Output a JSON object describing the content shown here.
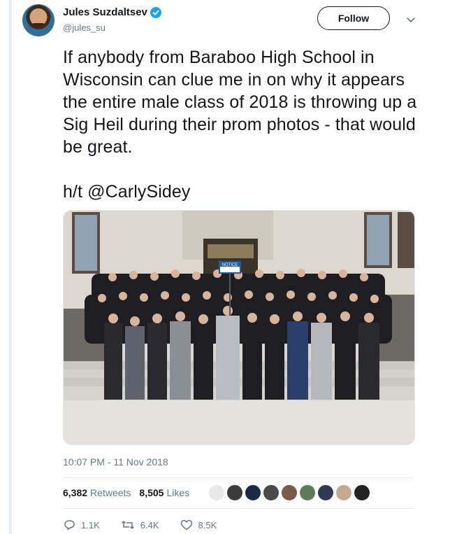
{
  "tweet": {
    "author": {
      "display_name": "Jules Suzdaltsev",
      "handle": "@jules_su",
      "verified": true
    },
    "follow_label": "Follow",
    "text": "If anybody from Baraboo High School in Wisconsin can clue me in on why it appears the entire male class of 2018 is throwing up a Sig Heil during their prom photos - that would be great.\n\nh/t @CarlySidey",
    "photo_sign_text": "NOTICE",
    "timestamp": "10:07 PM - 11 Nov 2018",
    "stats": {
      "retweets_count": "6,382",
      "retweets_label": "Retweets",
      "likes_count": "8,505",
      "likes_label": "Likes"
    },
    "actions": {
      "reply_count": "1.1K",
      "retweet_count": "6.4K",
      "like_count": "8.5K"
    },
    "icons": {
      "verified": "verified-badge-icon",
      "caret": "chevron-down-icon",
      "reply": "reply-icon",
      "retweet": "retweet-icon",
      "like": "heart-icon"
    },
    "colors": {
      "verified": "#1da1f2",
      "text": "#14171a",
      "secondary": "#657786",
      "divider": "#e6ecf0"
    }
  }
}
